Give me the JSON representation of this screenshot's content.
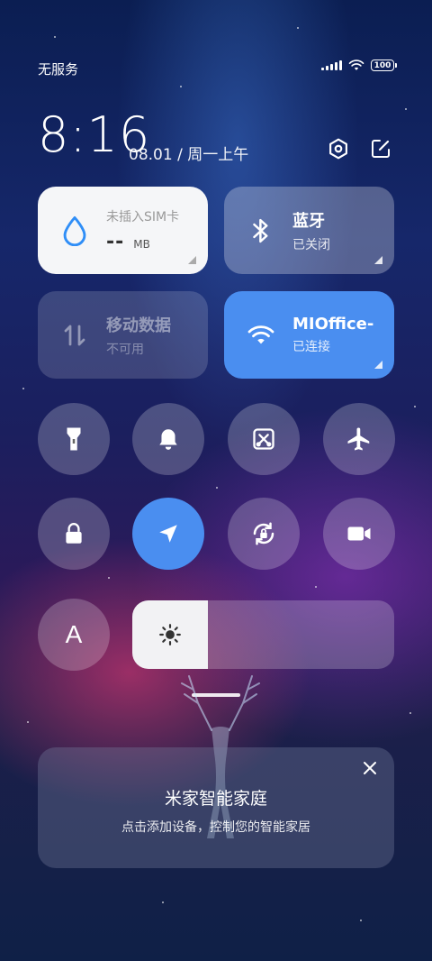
{
  "status": {
    "carrier": "无服务",
    "battery": "100"
  },
  "header": {
    "time": "8:16",
    "date": "08.01 / 周一上午"
  },
  "tiles": {
    "sim": {
      "title": "未插入SIM卡",
      "value": "--",
      "unit": "MB"
    },
    "bluetooth": {
      "title": "蓝牙",
      "status": "已关闭"
    },
    "mobile_data": {
      "title": "移动数据",
      "status": "不可用"
    },
    "wifi": {
      "title": "MIOffice-",
      "status": "已连接"
    }
  },
  "toggles": [
    {
      "icon": "flashlight-icon",
      "active": false
    },
    {
      "icon": "bell-icon",
      "active": false
    },
    {
      "icon": "screenshot-icon",
      "active": false
    },
    {
      "icon": "airplane-icon",
      "active": false
    },
    {
      "icon": "lock-icon",
      "active": false
    },
    {
      "icon": "location-icon",
      "active": true
    },
    {
      "icon": "rotation-lock-icon",
      "active": false
    },
    {
      "icon": "video-camera-icon",
      "active": false
    }
  ],
  "font_button": {
    "label": "A"
  },
  "brightness": {
    "level": 0.29
  },
  "smart_home_card": {
    "title": "米家智能家庭",
    "subtitle": "点击添加设备，控制您的智能家居"
  },
  "colors": {
    "accent": "#4a8ef0",
    "sim_tile": "#f5f6f8"
  }
}
